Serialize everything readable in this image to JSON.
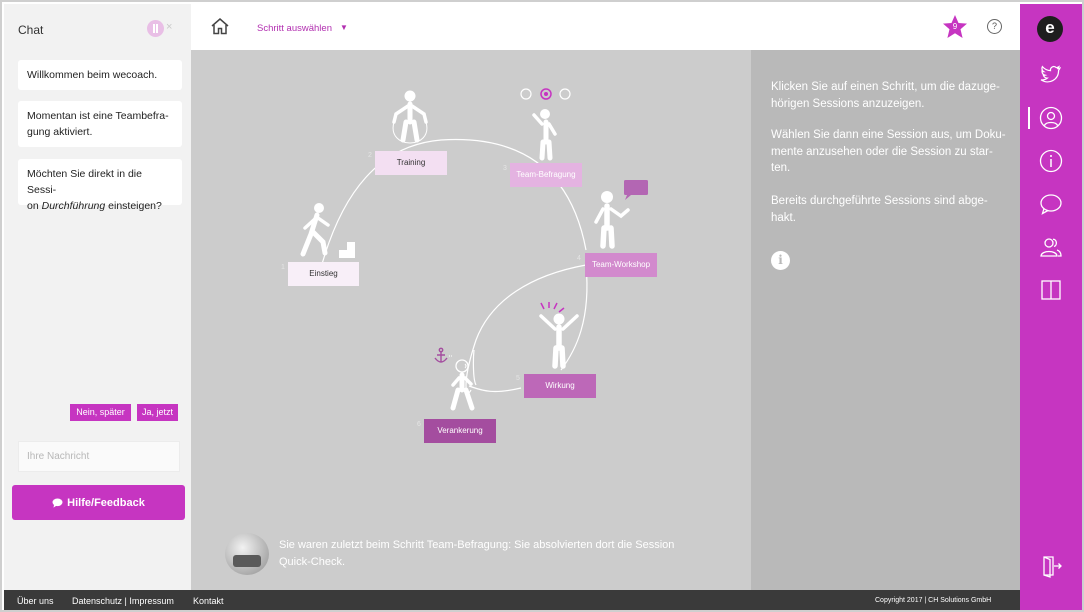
{
  "chat": {
    "title": "Chat",
    "close": "×",
    "messages": [
      {
        "line1": "Willkommen beim wecoach."
      },
      {
        "line1": "Momentan ist eine Teambefra-",
        "line2": "gung aktiviert."
      },
      {
        "line1": "Möchten Sie direkt in die Sessi-",
        "line2_prefix": "on ",
        "line2_em": "Durchführung",
        "line2_suffix": " einsteigen?"
      }
    ],
    "reply_later": "Nein, später",
    "reply_now": "Ja, jetzt",
    "input_placeholder": "Ihre Nachricht",
    "help_button": "Hilfe/Feedback"
  },
  "topbar": {
    "step_select": "Schritt auswählen",
    "star_count": "9",
    "help": "?"
  },
  "steps": [
    {
      "num": "1",
      "label": "Einstieg",
      "color": "#f8eff8",
      "text_color": "#333333"
    },
    {
      "num": "2",
      "label": "Training",
      "color": "#f3dff2",
      "text_color": "#333333"
    },
    {
      "num": "3",
      "label": "Team-Befragung",
      "color": "#e4b3e1",
      "text_color": "#ffffff"
    },
    {
      "num": "4",
      "label": "Team-Workshop",
      "color": "#d28acd",
      "text_color": "#ffffff"
    },
    {
      "num": "5",
      "label": "Wirkung",
      "color": "#bd68b8",
      "text_color": "#ffffff"
    },
    {
      "num": "6",
      "label": "Verankerung",
      "color": "#a44d9f",
      "text_color": "#ffffff"
    }
  ],
  "status_message": {
    "line1": "Sie waren zuletzt beim Schritt Team-Befragung: Sie absolvierten dort die Session",
    "line2": "Quick-Check."
  },
  "info": {
    "p1_l1": "Klicken Sie auf einen Schritt, um die dazuge-",
    "p1_l2": "hörigen Sessions anzuzeigen.",
    "p2_l1": "Wählen Sie dann eine Session aus, um Doku-",
    "p2_l2": "mente anzusehen oder die Session zu star-",
    "p2_l3": "ten.",
    "p3_l1": "Bereits durchgeführte Sessions sind abge-",
    "p3_l2": "hakt.",
    "icon": "i"
  },
  "rail": {
    "logo": "e",
    "icons": [
      "twitter-icon",
      "user-circle-icon",
      "info-circle-icon",
      "speech-bubble-icon",
      "users-icon",
      "book-icon",
      "exit-door-icon"
    ]
  },
  "footer": {
    "about": "Über uns",
    "privacy": "Datenschutz | Impressum",
    "contact": "Kontakt",
    "copyright": "Copyright 2017 | CH Solutions GmbH"
  },
  "colors": {
    "accent": "#c635c1",
    "stage": "#cccccc",
    "info_panel": "#b9b9b9",
    "footer": "#3a3a3a"
  }
}
